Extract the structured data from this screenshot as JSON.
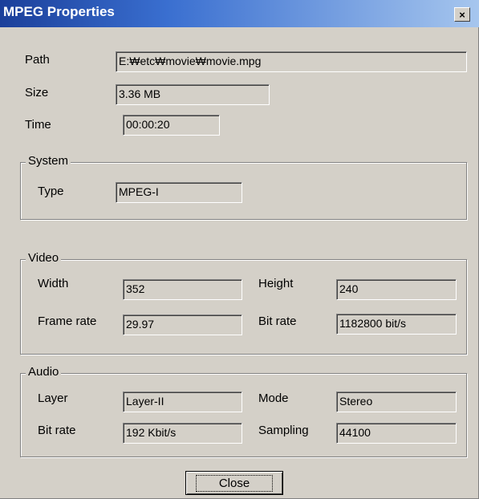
{
  "window": {
    "title": "MPEG Properties",
    "close_glyph": "×"
  },
  "general": {
    "path_label": "Path",
    "path_value": "E:₩etc₩movie₩movie.mpg",
    "size_label": "Size",
    "size_value": "3.36 MB",
    "time_label": "Time",
    "time_value": "00:00:20"
  },
  "system": {
    "title": "System",
    "type_label": "Type",
    "type_value": "MPEG-I"
  },
  "video": {
    "title": "Video",
    "width_label": "Width",
    "width_value": "352",
    "height_label": "Height",
    "height_value": "240",
    "framerate_label": "Frame rate",
    "framerate_value": "29.97",
    "bitrate_label": "Bit rate",
    "bitrate_value": "1182800 bit/s"
  },
  "audio": {
    "title": "Audio",
    "layer_label": "Layer",
    "layer_value": "Layer-II",
    "mode_label": "Mode",
    "mode_value": "Stereo",
    "bitrate_label": "Bit rate",
    "bitrate_value": "192 Kbit/s",
    "sampling_label": "Sampling",
    "sampling_value": "44100"
  },
  "buttons": {
    "close_label": "Close"
  },
  "colors": {
    "titlebar_start": "#1b3f9a",
    "titlebar_end": "#a6c6ee",
    "face": "#d4d0c8"
  }
}
